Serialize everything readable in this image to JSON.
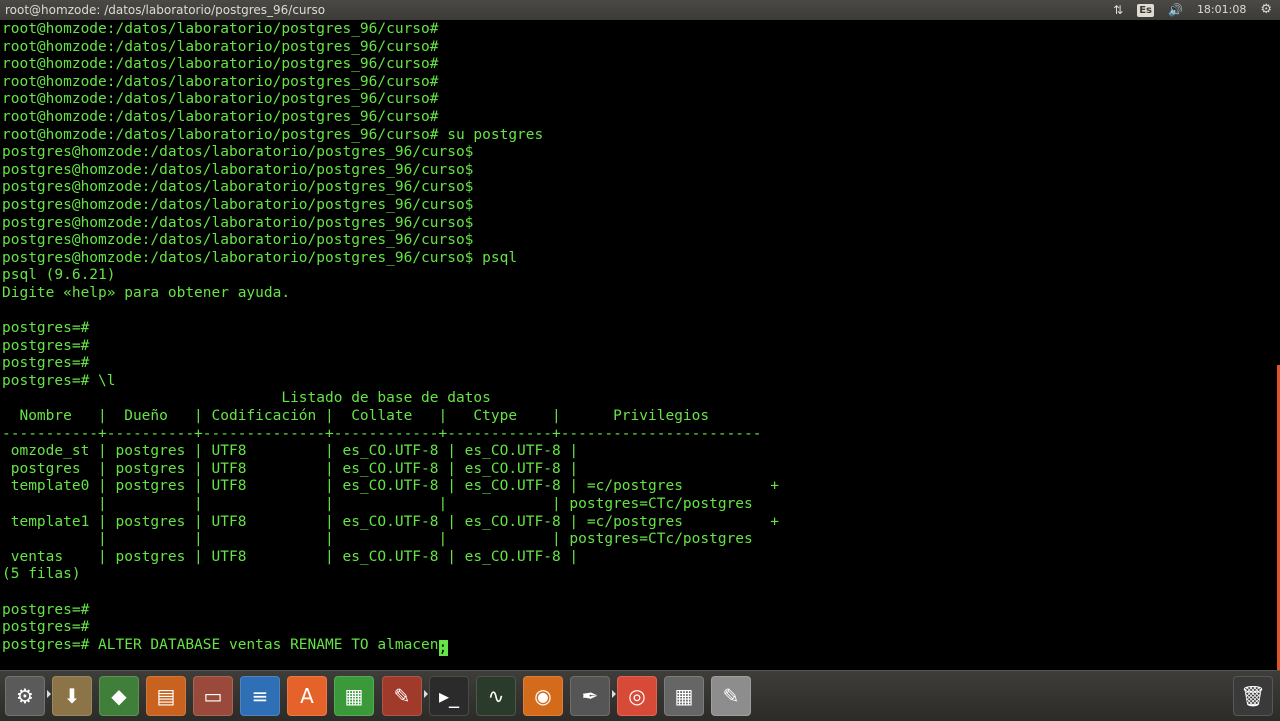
{
  "window": {
    "title": "root@homzode: /datos/laboratorio/postgres_96/curso"
  },
  "tray": {
    "keyboard_layout": "Es",
    "clock": "18:01:08"
  },
  "terminal": {
    "lines": [
      "root@homzode:/datos/laboratorio/postgres_96/curso#",
      "root@homzode:/datos/laboratorio/postgres_96/curso#",
      "root@homzode:/datos/laboratorio/postgres_96/curso#",
      "root@homzode:/datos/laboratorio/postgres_96/curso#",
      "root@homzode:/datos/laboratorio/postgres_96/curso#",
      "root@homzode:/datos/laboratorio/postgres_96/curso#",
      "root@homzode:/datos/laboratorio/postgres_96/curso# su postgres",
      "postgres@homzode:/datos/laboratorio/postgres_96/curso$",
      "postgres@homzode:/datos/laboratorio/postgres_96/curso$",
      "postgres@homzode:/datos/laboratorio/postgres_96/curso$",
      "postgres@homzode:/datos/laboratorio/postgres_96/curso$",
      "postgres@homzode:/datos/laboratorio/postgres_96/curso$",
      "postgres@homzode:/datos/laboratorio/postgres_96/curso$",
      "postgres@homzode:/datos/laboratorio/postgres_96/curso$ psql",
      "psql (9.6.21)",
      "Digite «help» para obtener ayuda.",
      "",
      "postgres=#",
      "postgres=#",
      "postgres=#",
      "postgres=# \\l",
      "                                Listado de base de datos",
      "  Nombre   |  Dueño   | Codificación |  Collate   |   Ctype    |      Privilegios",
      "-----------+----------+--------------+------------+------------+-----------------------",
      " omzode_st | postgres | UTF8         | es_CO.UTF-8 | es_CO.UTF-8 |",
      " postgres  | postgres | UTF8         | es_CO.UTF-8 | es_CO.UTF-8 |",
      " template0 | postgres | UTF8         | es_CO.UTF-8 | es_CO.UTF-8 | =c/postgres          +",
      "           |          |              |            |            | postgres=CTc/postgres",
      " template1 | postgres | UTF8         | es_CO.UTF-8 | es_CO.UTF-8 | =c/postgres          +",
      "           |          |              |            |            | postgres=CTc/postgres",
      " ventas    | postgres | UTF8         | es_CO.UTF-8 | es_CO.UTF-8 |",
      "(5 filas)",
      "",
      "postgres=#",
      "postgres=#"
    ],
    "current_input": "postgres=# ALTER DATABASE ventas RENAME TO almacen",
    "cursor_char": ";"
  },
  "launcher": {
    "items": [
      {
        "name": "system-settings",
        "glyph": "⚙",
        "color": "#5a5a5a"
      },
      {
        "name": "files",
        "glyph": "⬇",
        "color": "#8a7448"
      },
      {
        "name": "android-studio",
        "glyph": "◆",
        "color": "#3f7f3a"
      },
      {
        "name": "impress",
        "glyph": "▤",
        "color": "#c8621e"
      },
      {
        "name": "file-archive",
        "glyph": "▭",
        "color": "#9a4a3a"
      },
      {
        "name": "writer",
        "glyph": "≡",
        "color": "#2f6fb5"
      },
      {
        "name": "software-center",
        "glyph": "A",
        "color": "#e5622a"
      },
      {
        "name": "calc",
        "glyph": "▦",
        "color": "#3a9a3a"
      },
      {
        "name": "system-tools",
        "glyph": "✎",
        "color": "#a03a2a"
      },
      {
        "name": "terminal",
        "glyph": "▸_",
        "color": "#2b2b2b"
      },
      {
        "name": "system-monitor",
        "glyph": "∿",
        "color": "#2b3b2b"
      },
      {
        "name": "blender",
        "glyph": "◉",
        "color": "#d36b1a"
      },
      {
        "name": "inkscape",
        "glyph": "✒",
        "color": "#555"
      },
      {
        "name": "chrome",
        "glyph": "◎",
        "color": "#d84a38"
      },
      {
        "name": "calculator",
        "glyph": "▦",
        "color": "#666"
      },
      {
        "name": "text-editor",
        "glyph": "✎",
        "color": "#8d8d8d"
      }
    ],
    "trash": {
      "name": "trash",
      "glyph": "🗑",
      "color": "#3a3a3a"
    }
  }
}
